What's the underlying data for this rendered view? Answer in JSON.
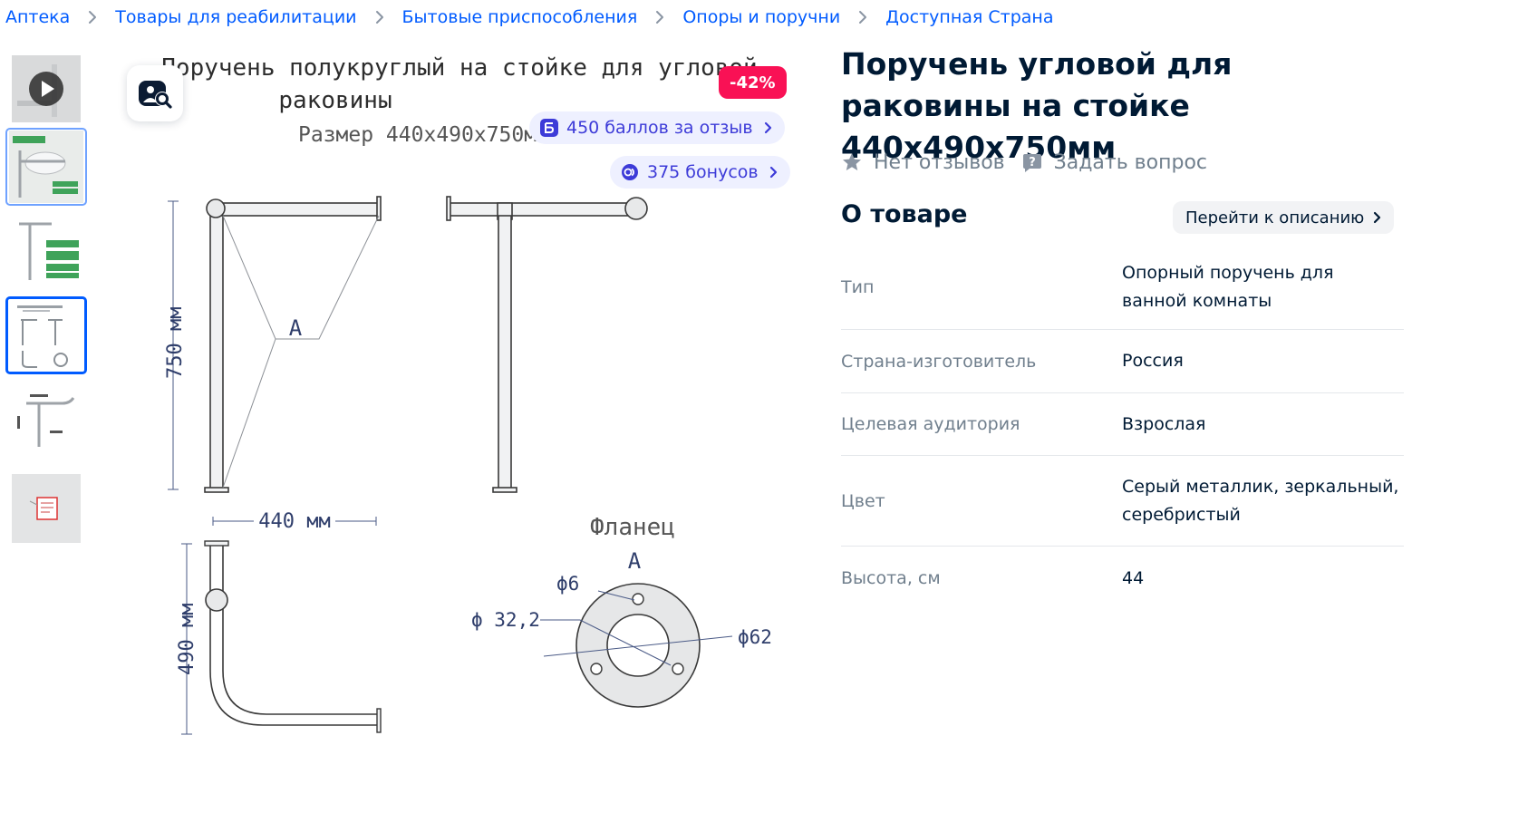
{
  "breadcrumbs": [
    "Аптека",
    "Товары для реабилитации",
    "Бытовые приспособления",
    "Опоры и поручни",
    "Доступная Страна"
  ],
  "gallery": {
    "image": {
      "heading_line1": "Поручень полукруглый на стойке для угловой",
      "heading_line2": "раковины",
      "size_line": "Размер 440х490х750мм",
      "label_a": "А",
      "dim_750": "750 мм",
      "dim_440": "440 мм",
      "dim_490": "490 мм",
      "flange_title": "Фланец",
      "flange_label": "А",
      "d6": "ϕ6",
      "d32": "ϕ 32,2",
      "d62": "ϕ62"
    },
    "discount": "-42%",
    "review_points": "450 баллов за отзыв",
    "bonus": "375 бонусов"
  },
  "product": {
    "title": "Поручень угловой для раковины на стойке 440х490х750мм",
    "reviews": "Нет отзывов",
    "ask": "Задать вопрос"
  },
  "about": {
    "title": "О товаре",
    "goto": "Перейти к описанию",
    "specs": [
      {
        "key": "Тип",
        "value": "Опорный поручень для ванной комнаты"
      },
      {
        "key": "Страна-изготовитель",
        "value": "Россия"
      },
      {
        "key": "Целевая аудитория",
        "value": "Взрослая"
      },
      {
        "key": "Цвет",
        "value": "Серый металлик, зеркальный, серебристый"
      },
      {
        "key": "Высота, см",
        "value": "44"
      }
    ]
  },
  "colors": {
    "accent": "#005bff",
    "discount": "#f91155",
    "bonus_text": "#3d3bd8",
    "bonus_bg": "#eef0ff"
  }
}
